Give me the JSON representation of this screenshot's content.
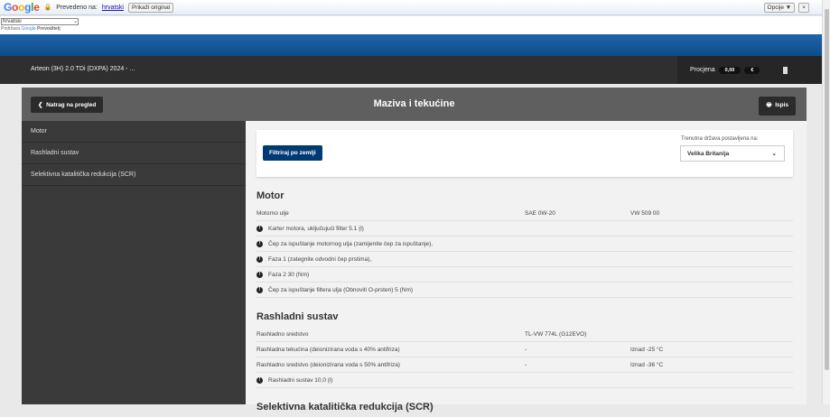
{
  "translate_bar": {
    "logo": "Google",
    "translated_to": "Prevedeno na:",
    "language": "hrvatski",
    "show_original": "Prikaži original",
    "options": "Opcije ▼",
    "close": "×",
    "select_value": "hrvatski",
    "powered_by": "Podržava",
    "powered_google": "Google",
    "powered_translate": "Prevoditelj"
  },
  "header": {
    "vehicle": "Arteon (3H) 2.0 TDi (DXPA) 2024 - ...",
    "estimate_label": "Procjena",
    "estimate_value": "0,00",
    "currency": "€"
  },
  "page": {
    "back": "Natrag na pregled",
    "title": "Maziva i tekućine",
    "print": "Ispis"
  },
  "sidebar": {
    "items": [
      {
        "label": "Motor"
      },
      {
        "label": "Rashladni sustav"
      },
      {
        "label": "Selektivna katalitička redukcija (SCR)"
      }
    ]
  },
  "filter": {
    "button": "Filtriraj po zemlji",
    "country_label": "Trenutna država postavljena na:",
    "country": "Velika Britanija"
  },
  "sections": [
    {
      "title": "Motor",
      "rows": [
        {
          "c1": "Motorno ulje",
          "c2": "SAE 0W-20",
          "c3": "VW 509 00"
        }
      ],
      "notes": [
        "Karter motora, uključujući filter 5.1 (l)",
        "Čep za ispuštanje motornog ulja (zamijenite čep za ispuštanje),",
        "Faza 1 (zategnite odvodni čep prstima),",
        "Faza 2 30 (Nm)",
        "Čep za ispuštanje filtera ulja (Obnoviti O-prsten) 5 (Nm)"
      ]
    },
    {
      "title": "Rashladni sustav",
      "rows": [
        {
          "c1": "Rashladno sredstvo",
          "c2": "TL-VW 774L (G12EVO)",
          "c3": ""
        },
        {
          "c1": "Rashladna tekućina (deionizirana voda s 40% antifriza)",
          "c2": "-",
          "c3": "Iznad -25 °C"
        },
        {
          "c1": "Rashladno sredstvo (deionizirana voda s 50% antifriza)",
          "c2": "-",
          "c3": "Iznad -36 °C"
        }
      ],
      "notes": [
        "Rashladni sustav 10,0 (l)"
      ]
    },
    {
      "title": "Selektivna katalitička redukcija (SCR)",
      "rows": [],
      "notes": []
    }
  ]
}
